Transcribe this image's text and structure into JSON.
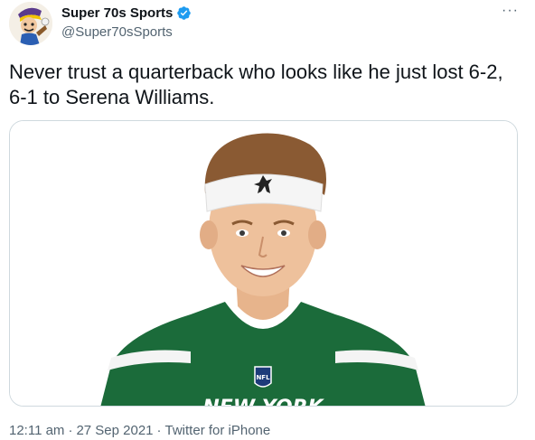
{
  "author": {
    "display_name": "Super 70s Sports",
    "handle": "@Super70sSports",
    "verified": true,
    "avatar_icon": "cartoon-mascot-avatar"
  },
  "menu": {
    "more_label": "···"
  },
  "tweet": {
    "text": "Never trust a quarterback who looks like he just lost 6-2, 6-1 to Serena Williams."
  },
  "media": {
    "description_icon": "player-headshot-photo",
    "jersey_text": "NEW YORK",
    "jersey_color": "#1b6b3a"
  },
  "meta": {
    "time": "12:11 am",
    "date": "27 Sep 2021",
    "separator": "·",
    "source": "Twitter for iPhone"
  },
  "colors": {
    "text_primary": "#0f1419",
    "text_secondary": "#536471",
    "verified_blue": "#1d9bf0",
    "border": "#cfd9de"
  }
}
